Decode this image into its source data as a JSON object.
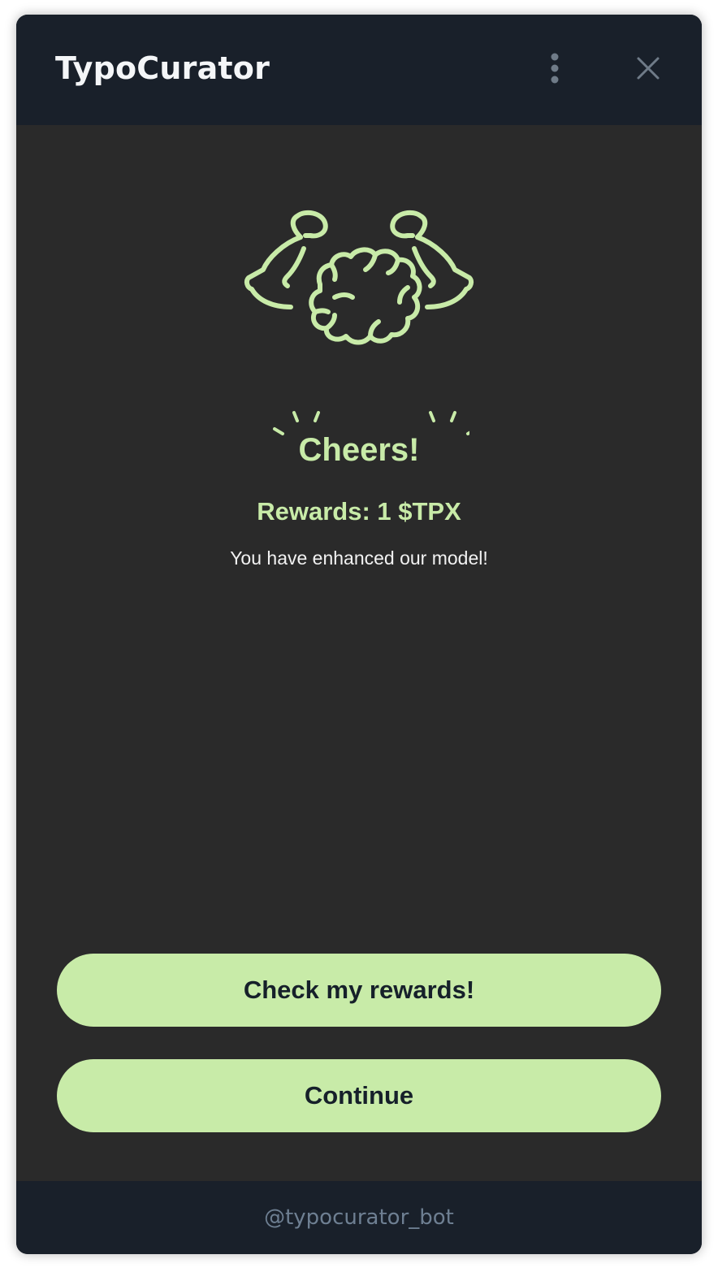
{
  "header": {
    "title": "TypoCurator",
    "menu_icon": "more-vertical-icon",
    "close_icon": "close-icon"
  },
  "main": {
    "illustration_icon": "strong-brain-icon",
    "heading": "Cheers!",
    "rewards": "Rewards: 1 $TPX",
    "message": "You have enhanced our model!"
  },
  "actions": {
    "check_rewards_label": "Check my rewards!",
    "continue_label": "Continue"
  },
  "footer": {
    "bot_handle": "@typocurator_bot"
  },
  "colors": {
    "accent": "#c8eba8",
    "header_bg": "#19202a",
    "content_bg": "#2a2a2a",
    "footer_text": "#6e7f92"
  }
}
